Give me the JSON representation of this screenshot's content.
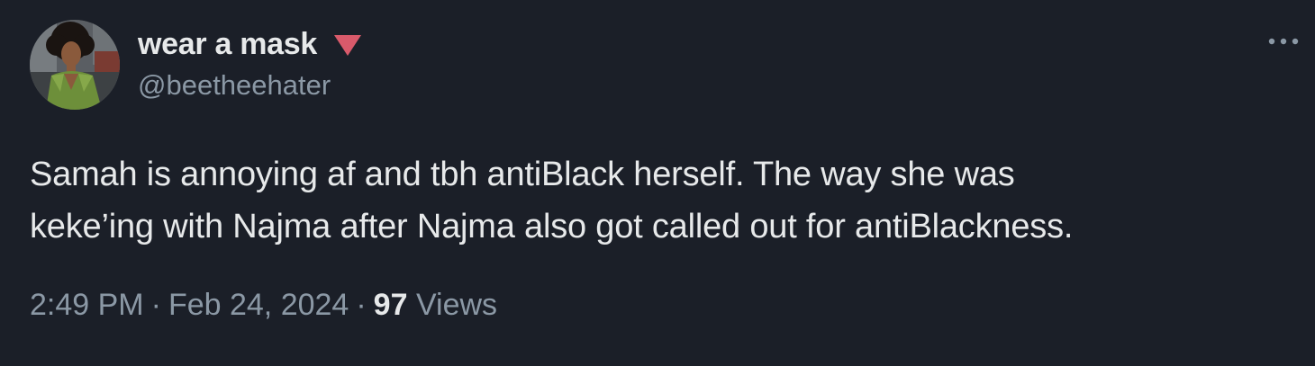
{
  "author": {
    "display_name": "wear a mask",
    "handle": "@beetheehater",
    "name_decoration_icon": "downward-triangle-icon",
    "name_decoration_color": "#d95a6b"
  },
  "tweet": {
    "lines": [
      "Samah is annoying af and tbh antiBlack herself. The way she was",
      "keke’ing with Najma after Najma also got called out for antiBlackness."
    ]
  },
  "meta": {
    "time": "2:49 PM",
    "separator": "·",
    "date": "Feb 24, 2024",
    "views_count": "97",
    "views_label": "Views"
  },
  "icons": {
    "more": "more-horizontal-icon",
    "avatar": "avatar-illustration"
  },
  "colors": {
    "background": "#1b1f28",
    "primary_text": "#e7e9ea",
    "secondary_text": "#8b98a5"
  }
}
